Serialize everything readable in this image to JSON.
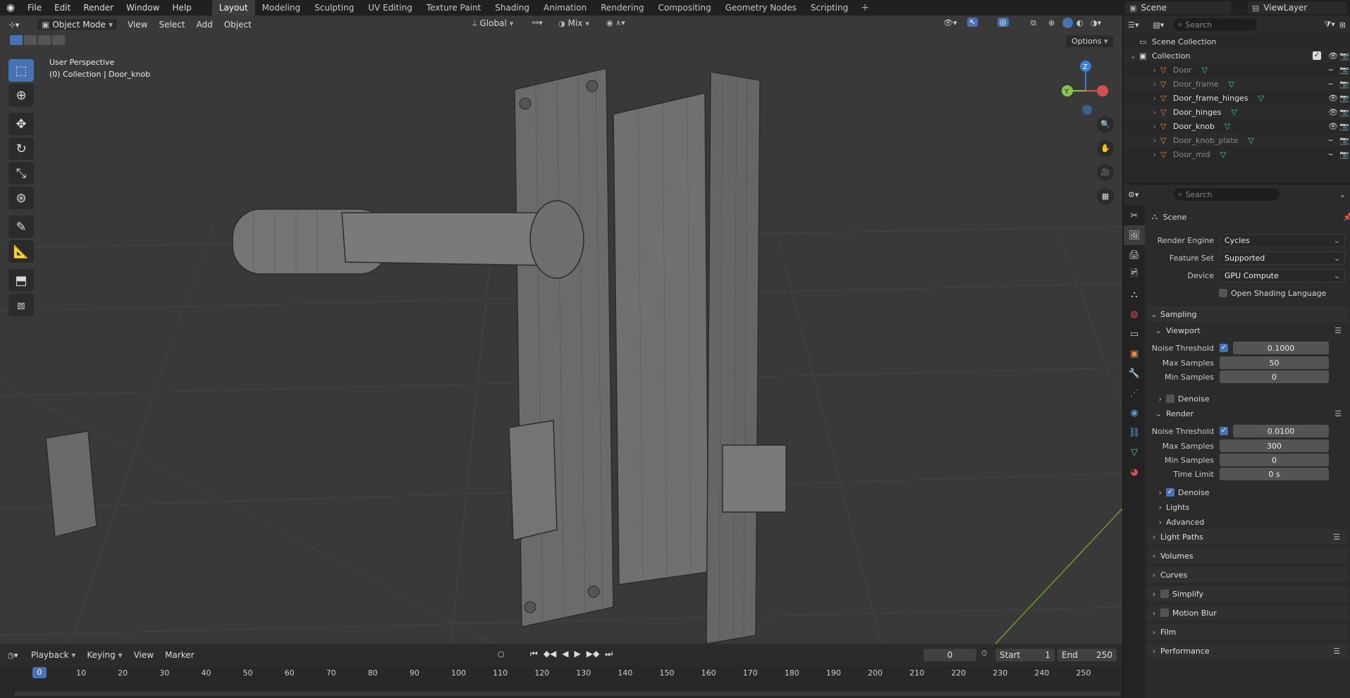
{
  "menu": [
    "File",
    "Edit",
    "Render",
    "Window",
    "Help"
  ],
  "workspaces": [
    "Layout",
    "Modeling",
    "Sculpting",
    "UV Editing",
    "Texture Paint",
    "Shading",
    "Animation",
    "Rendering",
    "Compositing",
    "Geometry Nodes",
    "Scripting"
  ],
  "scene_name": "Scene",
  "view_layer": "ViewLayer",
  "viewport": {
    "mode": "Object Mode",
    "menus": [
      "View",
      "Select",
      "Add",
      "Object"
    ],
    "orientation": "Global",
    "snap": "Mix",
    "options_label": "Options",
    "overlay_title": "User Perspective",
    "overlay_subtitle": "(0) Collection | Door_knob",
    "gizmo_axes": [
      "X",
      "Y",
      "Z"
    ]
  },
  "timeline": {
    "menus": [
      "Playback",
      "Keying",
      "View",
      "Marker"
    ],
    "current_frame": "0",
    "start_label": "Start",
    "start_value": "1",
    "end_label": "End",
    "end_value": "250",
    "ticks": [
      "0",
      "10",
      "20",
      "30",
      "40",
      "50",
      "60",
      "70",
      "80",
      "90",
      "100",
      "110",
      "120",
      "130",
      "140",
      "150",
      "160",
      "170",
      "180",
      "190",
      "200",
      "210",
      "220",
      "230",
      "240",
      "250"
    ]
  },
  "outliner": {
    "search_placeholder": "Search",
    "root": "Scene Collection",
    "collection": "Collection",
    "objects": [
      {
        "name": "Door",
        "visible": false
      },
      {
        "name": "Door_frame",
        "visible": false
      },
      {
        "name": "Door_frame_hinges",
        "visible": true
      },
      {
        "name": "Door_hinges",
        "visible": true
      },
      {
        "name": "Door_knob",
        "visible": true
      },
      {
        "name": "Door_knob_plate",
        "visible": false
      },
      {
        "name": "Door_mid",
        "visible": false
      }
    ]
  },
  "properties": {
    "search_placeholder": "Search",
    "context": "Scene",
    "render_engine_label": "Render Engine",
    "render_engine": "Cycles",
    "feature_set_label": "Feature Set",
    "feature_set": "Supported",
    "device_label": "Device",
    "device": "GPU Compute",
    "osl_label": "Open Shading Language",
    "sampling": "Sampling",
    "viewport_section": "Viewport",
    "vp_noise_label": "Noise Threshold",
    "vp_noise": "0.1000",
    "vp_max_label": "Max Samples",
    "vp_max": "50",
    "vp_min_label": "Min Samples",
    "vp_min": "0",
    "vp_denoise": "Denoise",
    "render_section": "Render",
    "r_noise_label": "Noise Threshold",
    "r_noise": "0.0100",
    "r_max_label": "Max Samples",
    "r_max": "300",
    "r_min_label": "Min Samples",
    "r_min": "0",
    "r_time_label": "Time Limit",
    "r_time": "0 s",
    "r_denoise": "Denoise",
    "lights": "Lights",
    "advanced": "Advanced",
    "panels": [
      "Light Paths",
      "Volumes",
      "Curves",
      "Simplify",
      "Motion Blur",
      "Film",
      "Performance"
    ]
  },
  "colors": {
    "accent": "#4772b3",
    "x_axis": "#d4504f",
    "y_axis": "#8bc34a",
    "z_axis": "#3d7fd4",
    "object_icon": "#e8883a",
    "mesh_data_icon": "#4cc9a4"
  }
}
